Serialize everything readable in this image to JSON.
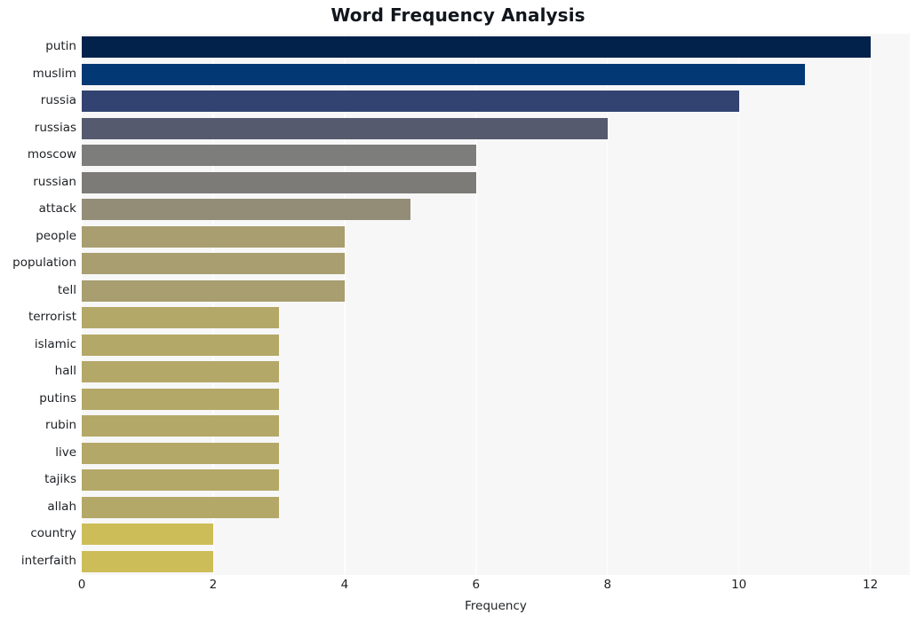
{
  "chart_data": {
    "type": "bar",
    "orientation": "horizontal",
    "title": "Word Frequency Analysis",
    "xlabel": "Frequency",
    "ylabel": "",
    "xlim": [
      0,
      12.6
    ],
    "xticks": [
      0,
      2,
      4,
      6,
      8,
      10,
      12
    ],
    "xticklabels": [
      "0",
      "2",
      "4",
      "6",
      "8",
      "10",
      "12"
    ],
    "grid": true,
    "grid_axis": "x",
    "legend": false,
    "categories": [
      "putin",
      "muslim",
      "russia",
      "russias",
      "moscow",
      "russian",
      "attack",
      "people",
      "population",
      "tell",
      "terrorist",
      "islamic",
      "hall",
      "putins",
      "rubin",
      "live",
      "tajiks",
      "allah",
      "country",
      "interfaith"
    ],
    "values": [
      12,
      11,
      10,
      8,
      6,
      6,
      5,
      4,
      4,
      4,
      3,
      3,
      3,
      3,
      3,
      3,
      3,
      3,
      2,
      2
    ],
    "bar_colors": [
      "#02224b",
      "#023874",
      "#334371",
      "#565a6e",
      "#7d7d7c",
      "#7c7b77",
      "#938d77",
      "#a89e6f",
      "#a89e6f",
      "#a89e6f",
      "#b4a868",
      "#b4a868",
      "#b4a868",
      "#b4a868",
      "#b4a868",
      "#b4a868",
      "#b4a868",
      "#b4a868",
      "#cdbd58",
      "#cdbd58"
    ],
    "plot_background": "#f7f7f8",
    "grid_color": "#fdfdfe",
    "figure_background": "#ffffff",
    "title_color": "#11161d",
    "tick_color": "#1d2024"
  }
}
